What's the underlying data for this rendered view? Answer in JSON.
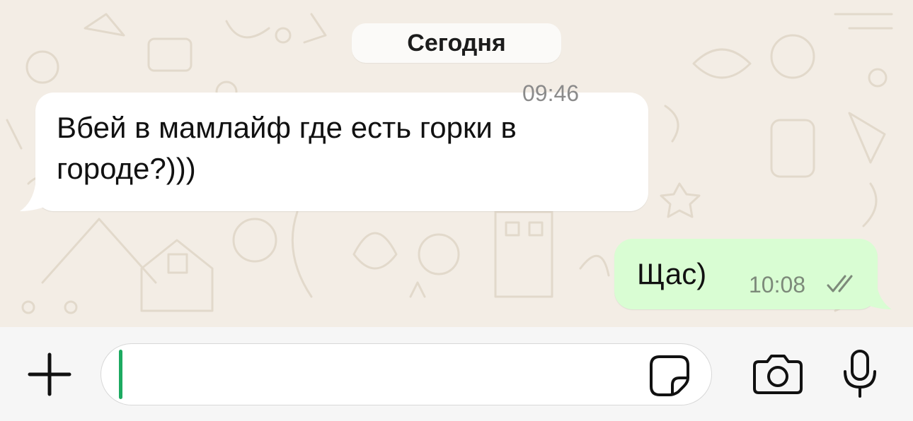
{
  "chat": {
    "date_label": "Сегодня",
    "messages": [
      {
        "direction": "incoming",
        "text": "Вбей в мамлайф где есть горки в городе?)))",
        "time": "09:46"
      },
      {
        "direction": "outgoing",
        "text": "Щас)",
        "time": "10:08",
        "status_icon": "double-check-icon"
      }
    ]
  },
  "composer": {
    "input_value": "",
    "icons": [
      "plus-icon",
      "sticker-icon",
      "camera-icon",
      "microphone-icon"
    ]
  },
  "colors": {
    "wallpaper": "#f3ede5",
    "incoming_bubble": "#ffffff",
    "outgoing_bubble": "#d9fdd3",
    "cursor": "#1daa61",
    "time_text": "#8b8b8b"
  }
}
